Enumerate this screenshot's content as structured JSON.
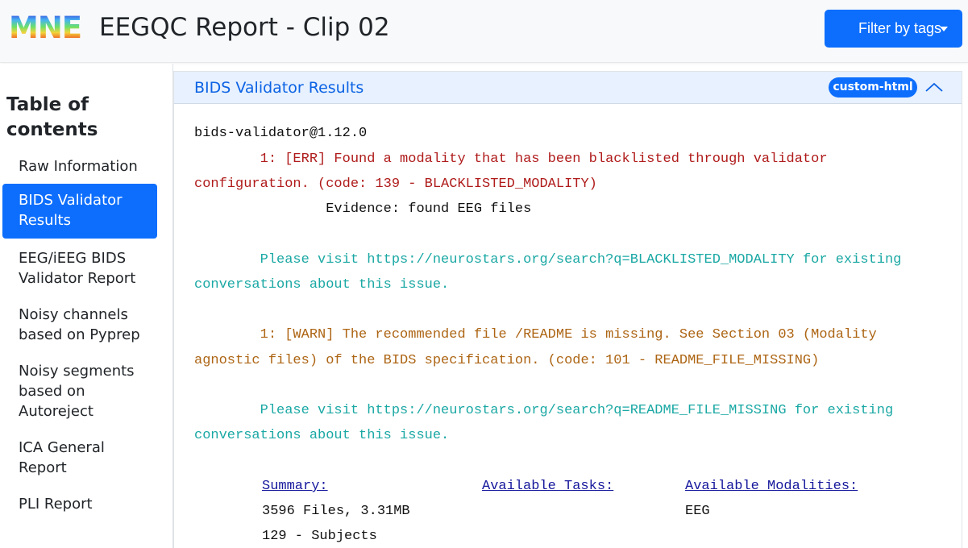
{
  "navbar": {
    "logo_text": "MNE",
    "title": "EEGQC Report - Clip 02",
    "filter_button": "Filter by tags"
  },
  "sidebar": {
    "heading": "Table of contents",
    "items": [
      {
        "label": "Raw Information",
        "active": false
      },
      {
        "label": "BIDS Validator Results",
        "active": true
      },
      {
        "label": "EEG/iEEG BIDS Validator Report",
        "active": false
      },
      {
        "label": "Noisy channels based on Pyprep",
        "active": false
      },
      {
        "label": "Noisy segments based on Autoreject",
        "active": false
      },
      {
        "label": "ICA General Report",
        "active": false
      },
      {
        "label": "PLI Report",
        "active": false
      }
    ]
  },
  "section": {
    "title": "BIDS Validator Results",
    "tag": "custom-html",
    "collapse_icon": "chevron-up-icon"
  },
  "validator": {
    "version_line": "bids-validator@1.12.0",
    "error": {
      "line1": "        1: [ERR] Found a modality that has been blacklisted through validator",
      "line2": "configuration. (code: 139 - BLACKLISTED_MODALITY)",
      "evidence": "                Evidence: found EEG files",
      "help1": "        Please visit https://neurostars.org/search?q=BLACKLISTED_MODALITY for existing",
      "help2": "conversations about this issue."
    },
    "warning": {
      "line1": "        1: [WARN] The recommended file /README is missing. See Section 03 (Modality",
      "line2": "agnostic files) of the BIDS specification. (code: 101 - README_FILE_MISSING)",
      "help1": "        Please visit https://neurostars.org/search?q=README_FILE_MISSING for existing",
      "help2": "conversations about this issue."
    },
    "summary": {
      "summary_heading": "Summary:",
      "tasks_heading": "Available Tasks:",
      "modalities_heading": "Available Modalities:",
      "files": "3596 Files, 3.31MB",
      "modality": "EEG",
      "subjects": "129 - Subjects"
    }
  },
  "colors": {
    "primary": "#0d6efd",
    "error": "#b01b1b",
    "warning": "#ad6514",
    "info": "#1aa8a4"
  }
}
